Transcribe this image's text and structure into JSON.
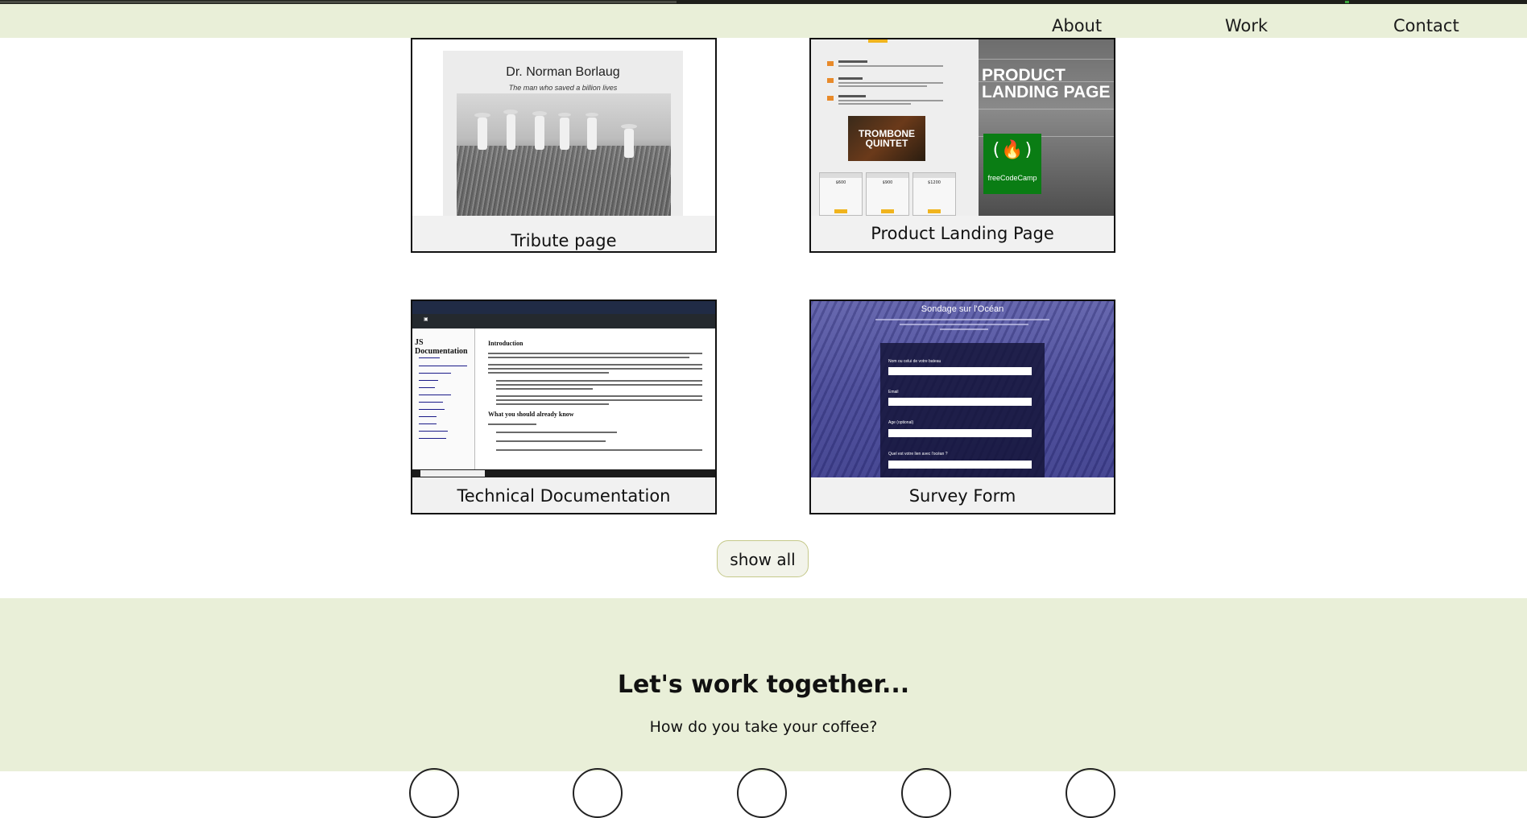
{
  "nav": {
    "items": [
      {
        "label": "About"
      },
      {
        "label": "Work"
      },
      {
        "label": "Contact"
      }
    ]
  },
  "projects": [
    {
      "title": "Tribute page",
      "preview": {
        "heading": "Dr. Norman Borlaug",
        "subheading": "The man who saved a billion lives"
      }
    },
    {
      "title": "Product Landing Page",
      "preview": {
        "hero_title": "PRODUCT LANDING PAGE",
        "brand": "freeCodeCamp",
        "video_title": "TROMBONE QUINTET",
        "prices": [
          "$600",
          "$900",
          "$1200"
        ]
      }
    },
    {
      "title": "Technical Documentation",
      "preview": {
        "sidebar_heading": "JS Documentation",
        "section_heading": "Introduction",
        "section_heading_2": "What you should already know"
      }
    },
    {
      "title": "Survey Form",
      "preview": {
        "heading": "Sondage sur l'Océan",
        "labels": [
          "Nom ou celui de votre bateau",
          "Email",
          "Age (optional)",
          "Quel est votre lien avec l'océan ?"
        ]
      }
    }
  ],
  "show_all_label": "show all",
  "footer": {
    "heading": "Let's work together...",
    "subheading": "How do you take your coffee?"
  },
  "colors": {
    "nav_bg": "#e9efd8",
    "footer_bg": "#e9efd8",
    "fcc_green": "#0a7d14",
    "survey_purple": "#4b4c97"
  }
}
